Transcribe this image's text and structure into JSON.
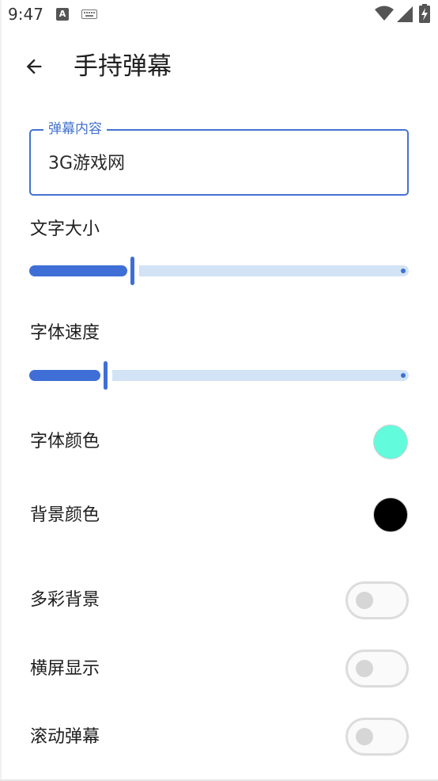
{
  "status_bar": {
    "time": "9:47",
    "a_icon_glyph": "A"
  },
  "app_bar": {
    "title": "手持弹幕"
  },
  "content_field": {
    "label": "弹幕内容",
    "value": "3G游戏网"
  },
  "text_size": {
    "label": "文字大小",
    "value_fraction": 0.27
  },
  "font_speed": {
    "label": "字体速度",
    "value_fraction": 0.2
  },
  "font_color": {
    "label": "字体颜色",
    "color": "#62fbdc"
  },
  "background_color": {
    "label": "背景颜色",
    "color": "#000000"
  },
  "toggles": [
    {
      "label": "多彩背景",
      "on": false
    },
    {
      "label": "横屏显示",
      "on": false
    },
    {
      "label": "滚动弹幕",
      "on": false
    }
  ],
  "colors": {
    "accent": "#3f6fd6",
    "track_inactive": "#d2e3f5"
  }
}
